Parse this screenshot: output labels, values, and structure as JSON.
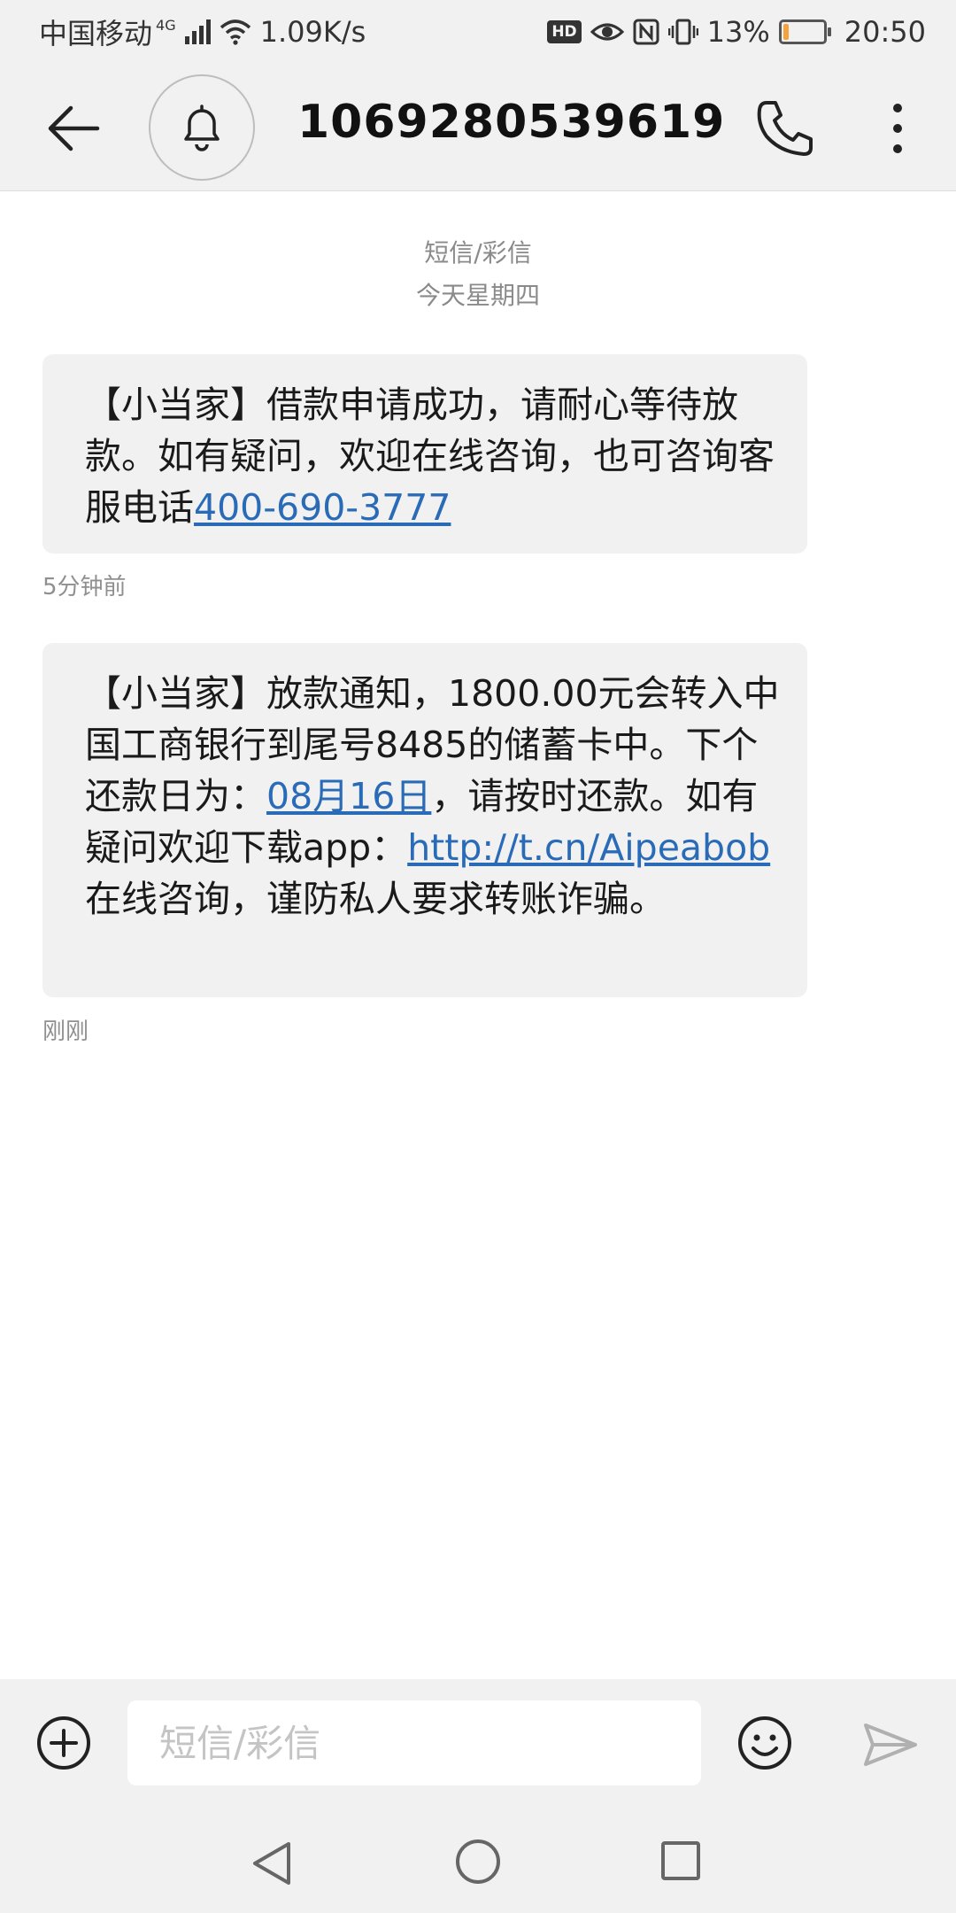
{
  "status_bar": {
    "carrier": "中国移动",
    "network": "4G",
    "speed": "1.09K/s",
    "hd": "HD",
    "battery_percent": "13%",
    "battery_level": 0.13,
    "time": "20:50"
  },
  "header": {
    "title": "1069280539619"
  },
  "thread": {
    "type_label": "短信/彩信",
    "date_label": "今天星期四",
    "messages": [
      {
        "text_before": "【小当家】借款申请成功，请耐心等待放款。如有疑问，欢迎在线咨询，也可咨询客服电话",
        "phone_link": "400-690-3777",
        "time": "5分钟前"
      },
      {
        "text_1": "【小当家】放款通知，1800.00元会转入中国工商银行到尾号8485的储蓄卡中。下个还款日为：",
        "date_link": "08月16日",
        "text_2": "，请按时还款。如有疑问欢迎下载app：",
        "url_link": "http://t.cn/Aipeabob",
        "text_3": "在线咨询，谨防私人要求转账诈骗。",
        "time": "刚刚"
      }
    ]
  },
  "composer": {
    "placeholder": "短信/彩信"
  },
  "colors": {
    "link": "#2a6bb8",
    "battery_fill": "#f5a13d",
    "bubble_bg": "#f1f1f1"
  },
  "icons": [
    "back-arrow-icon",
    "bell-icon",
    "phone-icon",
    "more-vertical-icon",
    "add-icon",
    "emoji-icon",
    "send-icon",
    "nav-back-icon",
    "nav-home-icon",
    "nav-recent-icon"
  ]
}
